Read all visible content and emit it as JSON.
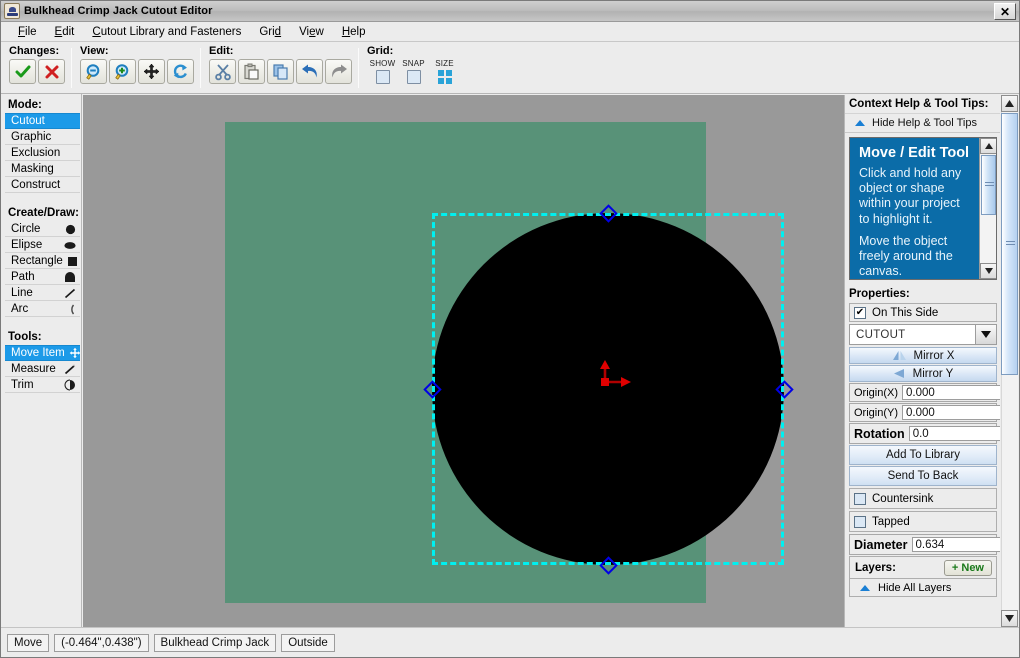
{
  "window": {
    "title": "Bulkhead Crimp Jack Cutout Editor",
    "app_icon": "java-coffee-cup-icon",
    "close_label": "✕"
  },
  "menubar": {
    "items": [
      {
        "label": "File",
        "mnemonic": "F"
      },
      {
        "label": "Edit",
        "mnemonic": "E"
      },
      {
        "label": "Cutout Library and Fasteners",
        "mnemonic": "C"
      },
      {
        "label": "Grid",
        "mnemonic": "d"
      },
      {
        "label": "View",
        "mnemonic": "e"
      },
      {
        "label": "Help",
        "mnemonic": "H"
      }
    ]
  },
  "toolbar": {
    "changes": {
      "label": "Changes:",
      "buttons": [
        {
          "name": "accept-changes-button",
          "icon": "check-icon",
          "color": "#1a9a1a"
        },
        {
          "name": "reject-changes-button",
          "icon": "cross-icon",
          "color": "#d02020"
        }
      ]
    },
    "view": {
      "label": "View:",
      "buttons": [
        {
          "name": "zoom-out-button",
          "icon": "zoom-out-icon"
        },
        {
          "name": "zoom-in-button",
          "icon": "zoom-in-icon"
        },
        {
          "name": "pan-button",
          "icon": "move-arrows-icon"
        },
        {
          "name": "refresh-button",
          "icon": "refresh-icon"
        }
      ]
    },
    "edit": {
      "label": "Edit:",
      "buttons": [
        {
          "name": "cut-button",
          "icon": "scissors-icon"
        },
        {
          "name": "paste-button",
          "icon": "paste-icon"
        },
        {
          "name": "copy-button",
          "icon": "copy-icon"
        },
        {
          "name": "undo-button",
          "icon": "undo-arrow-icon"
        },
        {
          "name": "redo-button",
          "icon": "redo-arrow-icon"
        }
      ]
    },
    "grid": {
      "label": "Grid:",
      "show_label": "SHOW",
      "snap_label": "SNAP",
      "size_label": "SIZE",
      "show_checked": false,
      "snap_checked": false
    }
  },
  "sidebar": {
    "mode_heading": "Mode:",
    "modes": [
      {
        "label": "Cutout",
        "selected": true
      },
      {
        "label": "Graphic",
        "selected": false
      },
      {
        "label": "Exclusion",
        "selected": false
      },
      {
        "label": "Masking",
        "selected": false
      },
      {
        "label": "Construct",
        "selected": false
      }
    ],
    "draw_heading": "Create/Draw:",
    "draw_items": [
      {
        "label": "Circle",
        "icon": "filled-circle-icon"
      },
      {
        "label": "Elipse",
        "icon": "filled-ellipse-icon"
      },
      {
        "label": "Rectangle",
        "icon": "filled-square-icon"
      },
      {
        "label": "Path",
        "icon": "path-icon"
      },
      {
        "label": "Line",
        "icon": "line-icon"
      },
      {
        "label": "Arc",
        "icon": "arc-icon"
      }
    ],
    "tools_heading": "Tools:",
    "tools": [
      {
        "label": "Move Item",
        "icon": "move-arrows-icon",
        "selected": true
      },
      {
        "label": "Measure",
        "icon": "ruler-pencil-icon",
        "selected": false
      },
      {
        "label": "Trim",
        "icon": "trim-icon",
        "selected": false
      }
    ]
  },
  "canvas": {
    "background_color": "#999999",
    "worksheet_color": "#589278",
    "shape_color": "#000000",
    "selection_color": "#00f0f0",
    "handle_color": "#0000e6",
    "origin_color": "#e00000"
  },
  "help_panel": {
    "heading": "Context Help & Tool Tips:",
    "toggle_label": "Hide Help & Tool Tips",
    "tip_title": "Move / Edit Tool",
    "tip_paragraphs": [
      "Click and hold any object or shape within your project to highlight it.",
      "Move the object freely around the canvas."
    ]
  },
  "properties": {
    "heading": "Properties:",
    "on_this_side_label": "On This Side",
    "on_this_side_checked": true,
    "type_value": "CUTOUT",
    "mirror_x_label": "Mirror X",
    "mirror_y_label": "Mirror Y",
    "origin_x_label": "Origin(X)",
    "origin_x_value": "0.000",
    "origin_y_label": "Origin(Y)",
    "origin_y_value": "0.000",
    "rotation_label": "Rotation",
    "rotation_value": "0.0",
    "add_to_library_label": "Add To Library",
    "send_to_back_label": "Send To Back",
    "countersink_label": "Countersink",
    "countersink_checked": false,
    "tapped_label": "Tapped",
    "tapped_checked": false,
    "diameter_label": "Diameter",
    "diameter_value": "0.634"
  },
  "layers": {
    "heading": "Layers:",
    "new_button_label": "+ New",
    "hide_all_label": "Hide All Layers"
  },
  "statusbar": {
    "mode": "Move",
    "coordinates": "(-0.464\",0.438\")",
    "project": "Bulkhead Crimp Jack",
    "side": "Outside"
  }
}
